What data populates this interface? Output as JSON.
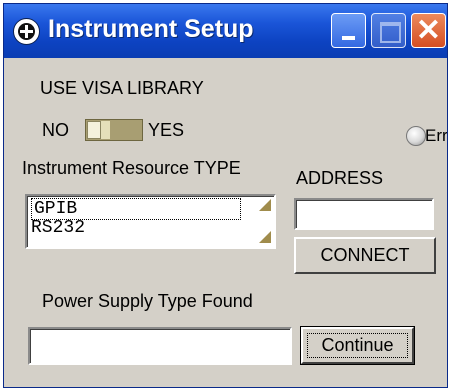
{
  "window": {
    "title": "Instrument Setup",
    "icon": "instrument-logo-icon"
  },
  "titlebar_buttons": {
    "minimize": "minimize-icon",
    "maximize": "maximize-icon",
    "close": "close-icon",
    "close_glyph": "✕"
  },
  "visa": {
    "heading": "USE VISA LIBRARY",
    "no_label": "NO",
    "yes_label": "YES",
    "value": "NO"
  },
  "error_indicator": {
    "label": "Error",
    "lit": false
  },
  "resource": {
    "heading": "Instrument Resource TYPE",
    "options": [
      "GPIB",
      "RS232"
    ],
    "selected": "GPIB"
  },
  "address": {
    "heading": "ADDRESS",
    "value": ""
  },
  "connect_button": {
    "label": "CONNECT"
  },
  "power_supply": {
    "heading": "Power Supply Type Found",
    "value": ""
  },
  "continue_button": {
    "label": "Continue"
  }
}
